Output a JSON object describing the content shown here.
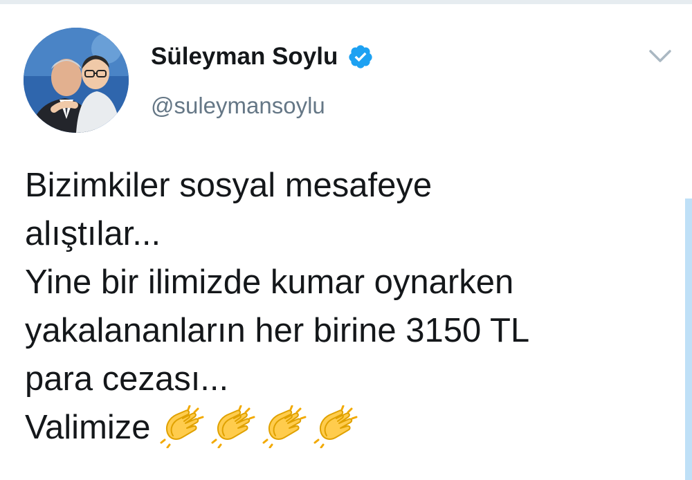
{
  "tweet": {
    "author": {
      "display_name": "Süleyman Soylu",
      "handle": "@suleymansoylu",
      "verified": true
    },
    "text_lines": [
      "Bizimkiler sosyal mesafeye",
      "alıştılar...",
      "Yine bir ilimizde kumar oynarken",
      "yakalananların her birine 3150 TL",
      "para cezası...",
      "Valimize"
    ],
    "emoji": [
      "clapping-hands",
      "clapping-hands",
      "clapping-hands",
      "clapping-hands"
    ]
  },
  "icons": {
    "verified": "verified-badge-icon",
    "menu": "chevron-down-icon",
    "emoji": "clapping-hands-icon"
  },
  "colors": {
    "verified_badge": "#1da1f2",
    "handle_text": "#657786",
    "primary_text": "#14171a",
    "chevron": "#aab8c2",
    "scroll_bar": "#bfe0f7"
  }
}
